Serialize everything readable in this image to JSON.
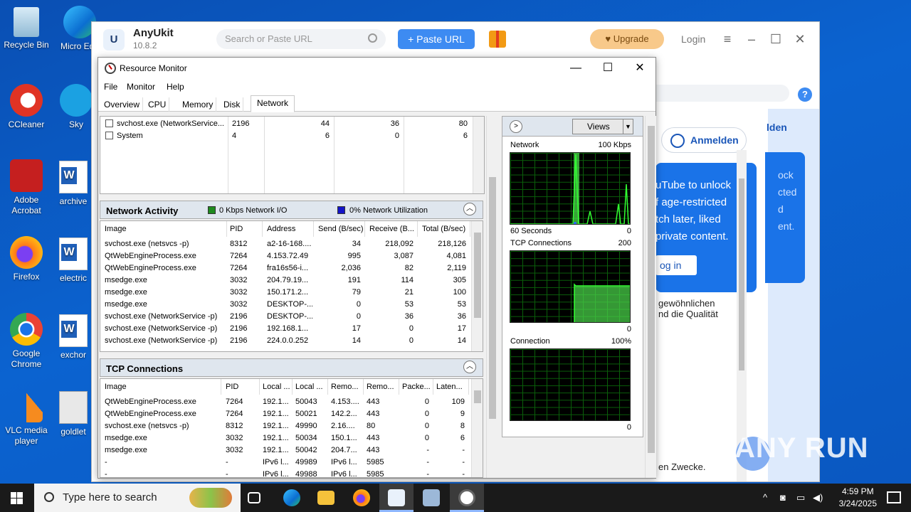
{
  "desktop": {
    "icons": [
      {
        "label": "Recycle Bin"
      },
      {
        "label": "Micro Edg"
      },
      {
        "label": "CCleaner"
      },
      {
        "label": "Sky"
      },
      {
        "label": "Adobe Acrobat"
      },
      {
        "label": "archive"
      },
      {
        "label": "Firefox"
      },
      {
        "label": "electric"
      },
      {
        "label": "Google Chrome"
      },
      {
        "label": "exchor"
      },
      {
        "label": "VLC media player"
      },
      {
        "label": "goldlet"
      }
    ]
  },
  "anyukit": {
    "title": "AnyUkit",
    "version": "10.8.2",
    "search_placeholder": "Search or Paste URL",
    "paste_label": "+ Paste URL",
    "upgrade_label": "Upgrade",
    "login_label": "Login",
    "help": "?",
    "anmelden": "Anmelden",
    "anmelden2": "lden",
    "promo_lines": [
      "uTube to unlock",
      "f age-restricted",
      "tch later, liked",
      "private content."
    ],
    "promo_login": "og in",
    "promo_right_lines": [
      "ock",
      "cted",
      "d",
      "ent."
    ],
    "de_text_1": "gewöhnlichen",
    "de_text_2": "nd die Qualität",
    "de_text_3": "en Zwecke."
  },
  "resmon": {
    "title": "Resource Monitor",
    "menu": [
      "File",
      "Monitor",
      "Help"
    ],
    "tabs": [
      "Overview",
      "CPU",
      "Memory",
      "Disk",
      "Network"
    ],
    "active_tab": "Network",
    "processes": [
      {
        "image": "svchost.exe (NetworkService...",
        "pid": "2196",
        "send": "44",
        "receive": "36",
        "total": "80"
      },
      {
        "image": "System",
        "pid": "4",
        "send": "6",
        "receive": "0",
        "total": "6"
      }
    ],
    "network_activity": {
      "title": "Network Activity",
      "legend_io": "0 Kbps Network I/O",
      "legend_util": "0% Network Utilization",
      "columns": [
        "Image",
        "PID",
        "Address",
        "Send (B/sec)",
        "Receive (B...",
        "Total (B/sec)"
      ],
      "rows": [
        [
          "svchost.exe (netsvcs -p)",
          "8312",
          "a2-16-168....",
          "34",
          "218,092",
          "218,126"
        ],
        [
          "QtWebEngineProcess.exe",
          "7264",
          "4.153.72.49",
          "995",
          "3,087",
          "4,081"
        ],
        [
          "QtWebEngineProcess.exe",
          "7264",
          "fra16s56-i...",
          "2,036",
          "82",
          "2,119"
        ],
        [
          "msedge.exe",
          "3032",
          "204.79.19...",
          "191",
          "114",
          "305"
        ],
        [
          "msedge.exe",
          "3032",
          "150.171.2...",
          "79",
          "21",
          "100"
        ],
        [
          "msedge.exe",
          "3032",
          "DESKTOP-...",
          "0",
          "53",
          "53"
        ],
        [
          "svchost.exe (NetworkService -p)",
          "2196",
          "DESKTOP-...",
          "0",
          "36",
          "36"
        ],
        [
          "svchost.exe (NetworkService -p)",
          "2196",
          "192.168.1...",
          "17",
          "0",
          "17"
        ],
        [
          "svchost.exe (NetworkService -p)",
          "2196",
          "224.0.0.252",
          "14",
          "0",
          "14"
        ]
      ]
    },
    "tcp": {
      "title": "TCP Connections",
      "columns": [
        "Image",
        "PID",
        "Local ...",
        "Local ...",
        "Remo...",
        "Remo...",
        "Packe...",
        "Laten..."
      ],
      "rows": [
        [
          "QtWebEngineProcess.exe",
          "7264",
          "192.1...",
          "50043",
          "4.153....",
          "443",
          "0",
          "109"
        ],
        [
          "QtWebEngineProcess.exe",
          "7264",
          "192.1...",
          "50021",
          "142.2...",
          "443",
          "0",
          "9"
        ],
        [
          "svchost.exe (netsvcs -p)",
          "8312",
          "192.1...",
          "49990",
          "2.16....",
          "80",
          "0",
          "8"
        ],
        [
          "msedge.exe",
          "3032",
          "192.1...",
          "50034",
          "150.1...",
          "443",
          "0",
          "6"
        ],
        [
          "msedge.exe",
          "3032",
          "192.1...",
          "50042",
          "204.7...",
          "443",
          "-",
          "-"
        ],
        [
          "-",
          "-",
          "IPv6 l...",
          "49989",
          "IPv6 l...",
          "5985",
          "-",
          "-"
        ],
        [
          "-",
          "-",
          "IPv6 l...",
          "49988",
          "IPv6 l...",
          "5985",
          "-",
          "-"
        ]
      ]
    },
    "graphs": {
      "views_label": "Views",
      "network_label": "Network",
      "network_max": "100 Kbps",
      "seconds_label": "60 Seconds",
      "zero": "0",
      "tcp_label": "TCP Connections",
      "tcp_max": "200",
      "conn_label": "Connection",
      "conn_max": "100%"
    }
  },
  "taskbar": {
    "search_placeholder": "Type here to search",
    "time": "4:59 PM",
    "date": "3/24/2025"
  },
  "watermark": "ANY RUN",
  "colors": {
    "desktop": "#0b63d0",
    "accent": "#3d8bf2",
    "graph_line": "#32ff32",
    "graph_grid": "#0a5f0a"
  }
}
